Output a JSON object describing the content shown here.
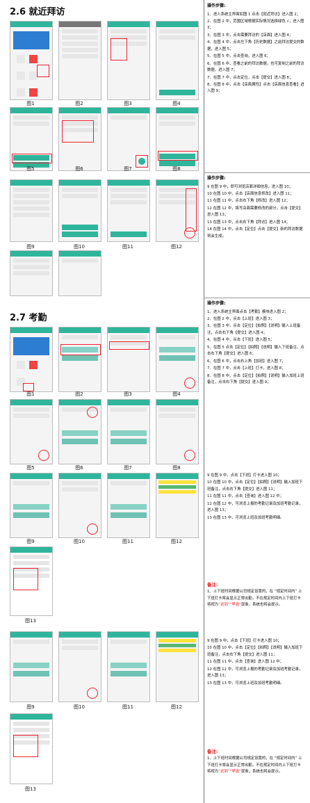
{
  "section_26": {
    "title": "2.6 就近拜访",
    "figure_labels_row1": [
      "图1",
      "图2",
      "图3",
      "图4"
    ],
    "figure_labels_row2": [
      "图5",
      "图6",
      "图7",
      "图8"
    ],
    "figure_labels_row3": [
      "图9",
      "图10",
      "图11",
      "图12"
    ],
    "steps_heading": "操作步骤:",
    "steps_a": [
      "1、进入系统主界面如图 1 点击【就近拜访】进入图 2；",
      "2、在图 2 中，范围区域根据实际情况选择绿色 √，进入图 3；",
      "3、在图 3 中，点击需要拜访的【店面】进入图 4；",
      "4、在图 4 中，点击左下角【历史数据】之前拜访提交的数据，进入图 5；",
      "5、在图 5 中，点击查询，进入图 6；",
      "6、在图 6 中，查看之前的拜访数据，也可复制之前的拜访数据，进入图 7；",
      "7、在图 7 中，点击定位，点击【提交】进入图 8；",
      "8、在图 8 中，点击【店面属性】点击【店面信息查看】进入图 9；"
    ],
    "steps_heading_b": "操作步骤:",
    "steps_b": [
      "9 在图 9 中，即可浏览店面详细信息，进入图 10；",
      "10 在图 10 中，点击【店面信息修改】进入图 11；",
      "11 在图 11 中，点击右下角【修改】进入图 12；",
      "12 在图 12 中，填写店面需要修改的部分，点击【提交】进入图 13；",
      "13 在图 13 中，点击右下角【拜访】进入图 14；",
      "14 在图 14 中，点击【定位】点击【提交】新的拜访数据将会生成。"
    ]
  },
  "section_27": {
    "title": "2.7 考勤",
    "figure_labels_a": [
      "图1",
      "图2",
      "图3",
      "图4"
    ],
    "figure_labels_b": [
      "图5",
      "图6",
      "图7",
      "图8"
    ],
    "figure_labels_c": [
      "图9",
      "图10",
      "图11",
      "图12"
    ],
    "figure_label_13": "图13",
    "steps_heading": "操作步骤:",
    "steps_a": [
      "1、进入系统主界面点击【考勤】模块进入图 2；",
      "2、在图 2 中，点击【上班】进入图 3；",
      "3、在图 3 中，点击【定位】【拍照】【说明】输入上班备注，点击右下角【提交】进入图 4；",
      "4、在图 4 中，点击【下班】进入图 5；",
      "5、在图 5 点击【定位】【拍照】【说明】输入下班备注，点击右下角【提交】进入图 6；",
      "6、在图 6 中，点击右上角【加班】进入图 7；",
      "7、在图 7 中，点击【上班】打卡，进入图 8；",
      "8、在图 8 中，点击【定位】【拍照】【说明】输入加班上班备注，点击右下角【提交】进入图 9；"
    ],
    "steps_b": [
      "9 在图 9 中，点击【下班】打卡进入图 10；",
      "10 在图 10 中，点击【定位】【拍照】【说明】输入加班下班备注，点击右下角【提交】进入图 11；",
      "11 在图 11 中，点击【查询】进入图 12 中；",
      "12 在图 12 中，可浏览上报的考勤记录及加班考勤记录，进入图 13；",
      "13 在图 13 中，可浏览上班及加班考勤明细。"
    ],
    "note_heading": "备注:",
    "note_text_1": "1、上下班时间根据公司规定设置的，在 “规定时间内” 上下班打卡将会显示正常出勤，不在规定时间内上下班打卡将视为",
    "note_red": "“迟到”“早退”",
    "note_text_2": "现象，系统也将会提示。"
  }
}
